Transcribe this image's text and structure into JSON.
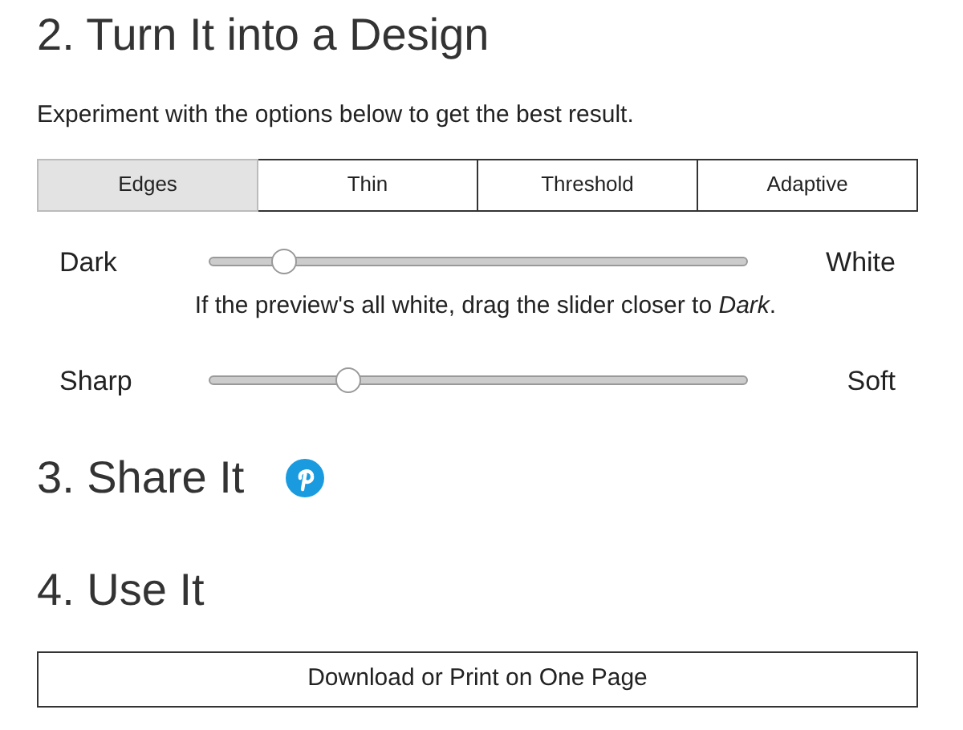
{
  "sections": [
    {
      "title": "2. Turn It into a Design"
    },
    {
      "title": "3. Share It"
    },
    {
      "title": "4. Use It"
    }
  ],
  "intro": "Experiment with the options below to get the best result.",
  "tabs": [
    {
      "label": "Edges",
      "selected": true
    },
    {
      "label": "Thin",
      "selected": false
    },
    {
      "label": "Threshold",
      "selected": false
    },
    {
      "label": "Adaptive",
      "selected": false
    }
  ],
  "sliders": [
    {
      "left": "Dark",
      "right": "White",
      "level": 0.14,
      "hint": "If the preview's all white, drag the slider closer to *Dark*."
    },
    {
      "left": "Sharp",
      "right": "Soft",
      "level": 0.26
    }
  ],
  "download_button": "Download or Print on One Page"
}
